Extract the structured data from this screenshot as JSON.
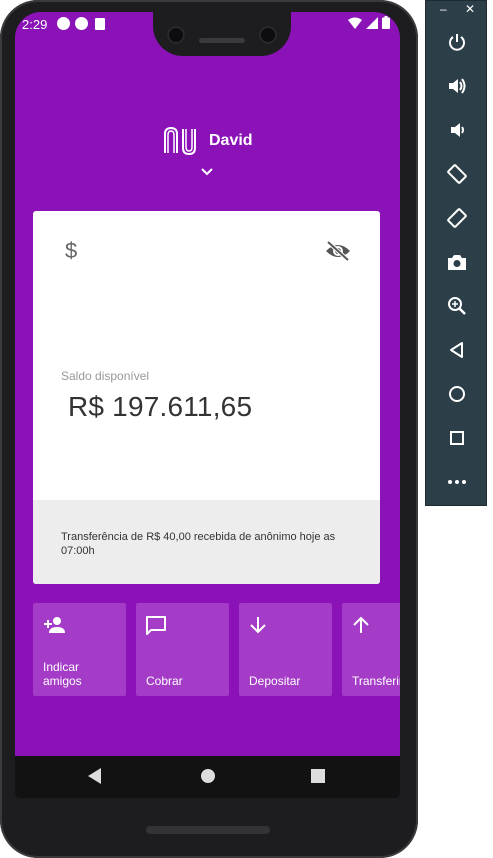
{
  "status_bar": {
    "time": "2:29"
  },
  "header": {
    "user_name": "David"
  },
  "account": {
    "balance_label": "Saldo disponível",
    "balance_value": "R$ 197.611,65",
    "last_transaction": "Transferência de R$ 40,00 recebida de anônimo hoje as 07:00h"
  },
  "shortcuts": [
    {
      "label": "Indicar\namigos",
      "icon": "person-add-icon"
    },
    {
      "label": "Cobrar",
      "icon": "chat-icon"
    },
    {
      "label": "Depositar",
      "icon": "arrow-down-icon"
    },
    {
      "label": "Transferir",
      "icon": "arrow-up-icon"
    }
  ],
  "emulator": {
    "buttons": [
      "power-icon",
      "volume-up-icon",
      "volume-down-icon",
      "rotate-left-icon",
      "rotate-right-icon",
      "camera-icon",
      "zoom-icon",
      "back-icon",
      "home-icon",
      "overview-icon",
      "more-icon"
    ]
  },
  "colors": {
    "brand": "#8a12b6",
    "tile": "#a43cc7"
  }
}
